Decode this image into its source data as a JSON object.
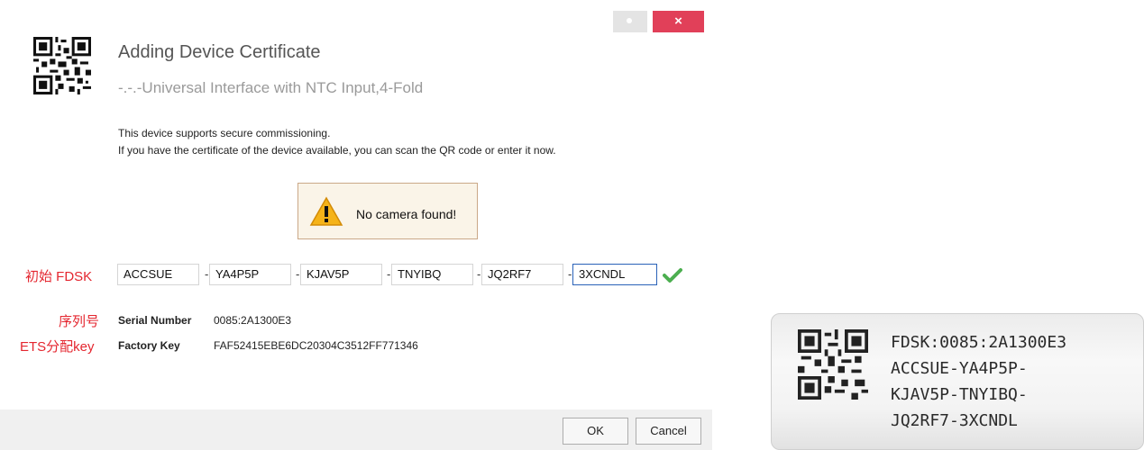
{
  "window": {
    "close_symbol": "×"
  },
  "dialog": {
    "title": "Adding Device Certificate",
    "subtitle": "-.-.-Universal Interface with NTC Input,4-Fold",
    "desc_line1": "This device supports secure commissioning.",
    "desc_line2": "If you have the certificate of the device available, you can scan the QR code or enter it now.",
    "warning": "No camera found!",
    "fdsk_annotation": "初始 FDSK",
    "fdsk_fields": [
      "ACCSUE",
      "YA4P5P",
      "KJAV5P",
      "TNYIBQ",
      "JQ2RF7",
      "3XCNDL"
    ],
    "dash": "-",
    "serial_annotation": "序列号",
    "serial_label": "Serial Number",
    "serial_value": "0085:2A1300E3",
    "key_annotation": "ETS分配key",
    "key_label": "Factory Key",
    "key_value": "FAF52415EBE6DC20304C3512FF771346",
    "ok_label": "OK",
    "cancel_label": "Cancel"
  },
  "device_label": {
    "line1": "FDSK:0085:2A1300E3",
    "line2": "ACCSUE-YA4P5P-",
    "line3": "KJAV5P-TNYIBQ-",
    "line4": "JQ2RF7-3XCNDL"
  },
  "colors": {
    "close_button": "#e14059",
    "annotation_red": "#e4262f",
    "check_green": "#4caf50",
    "warning_bg": "#faf4e8"
  },
  "icons": [
    "qr-code-icon",
    "warning-icon",
    "check-icon",
    "dot-icon"
  ]
}
